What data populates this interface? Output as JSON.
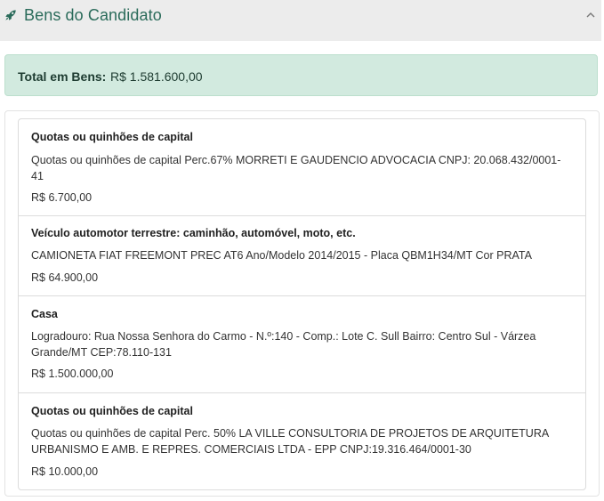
{
  "section": {
    "title": "Bens do Candidato",
    "icons": {
      "leading": "rocket-icon",
      "trailing": "chevron-up-icon"
    }
  },
  "total": {
    "label": "Total em Bens:",
    "value": "R$ 1.581.600,00"
  },
  "items": [
    {
      "title": "Quotas ou quinhões de capital",
      "description": "Quotas ou quinhões de capital Perc.67% MORRETI E GAUDENCIO ADVOCACIA CNPJ: 20.068.432/0001-41",
      "value": "R$ 6.700,00"
    },
    {
      "title": "Veículo automotor terrestre: caminhão, automóvel, moto, etc.",
      "description": "CAMIONETA FIAT FREEMONT PREC AT6 Ano/Modelo 2014/2015 - Placa QBM1H34/MT Cor PRATA",
      "value": "R$ 64.900,00"
    },
    {
      "title": "Casa",
      "description": "Logradouro: Rua Nossa Senhora do Carmo - N.º:140 - Comp.: Lote C. Sull Bairro: Centro Sul - Várzea Grande/MT CEP:78.110-131",
      "value": "R$ 1.500.000,00"
    },
    {
      "title": "Quotas ou quinhões de capital",
      "description": "Quotas ou quinhões de capital Perc. 50% LA VILLE CONSULTORIA DE PROJETOS DE ARQUITETURA URBANISMO E AMB. E REPRES. COMERCIAIS LTDA - EPP CNPJ:19.316.464/0001-30",
      "value": "R$ 10.000,00"
    }
  ],
  "colors": {
    "accent": "#2a6b5a",
    "header_bg": "#ececec",
    "total_bg": "#d2eadf",
    "total_border": "#bcdfcd"
  }
}
